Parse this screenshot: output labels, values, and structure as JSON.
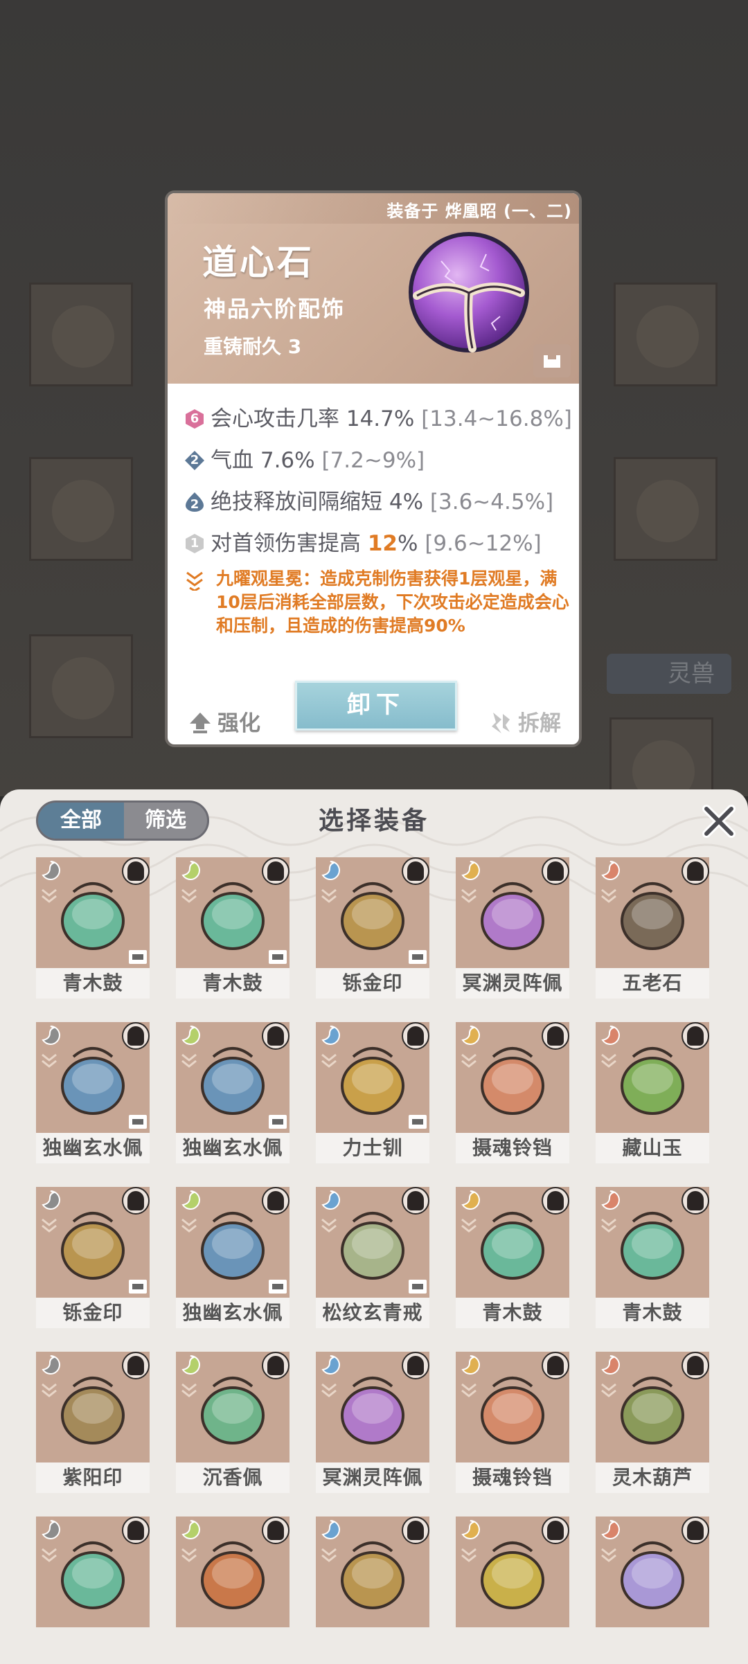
{
  "equipped_by": "装备于 烨凰昭 (一、二)",
  "item": {
    "name": "道心石",
    "grade": "神品六阶配饰",
    "durability": "重铸耐久 3"
  },
  "stats": [
    {
      "badge": "6",
      "badge_color": "#d9709a",
      "text": "会心攻击几率 14.7%",
      "range": "[13.4~16.8%]"
    },
    {
      "badge": "2",
      "badge_color": "#5c7896",
      "text": "气血 7.6%",
      "range": "[7.2~9%]"
    },
    {
      "badge": "2",
      "badge_color": "#5c7896",
      "text": "绝技释放间隔缩短 4%",
      "range": "[3.6~4.5%]"
    },
    {
      "badge": "1",
      "badge_color": "#c9c9c9",
      "text_pre": "对首领伤害提高 ",
      "text_hl": "12",
      "text_post": "%",
      "range": "[9.6~12%]"
    }
  ],
  "special": "九曜观星冕：造成克制伤害获得1层观星，满10层后消耗全部层数，下次攻击必定造成会心和压制，且造成的伤害提高90%",
  "actions": {
    "upgrade": "强化",
    "unequip": "卸下",
    "dismantle": "拆解"
  },
  "background": {
    "pet_label": "灵兽"
  },
  "panel": {
    "title": "选择装备",
    "tab_all": "全部",
    "tab_filter": "筛选"
  },
  "items": [
    {
      "name": "青木鼓",
      "icon": "drum-icon",
      "color": "#6ab89a"
    },
    {
      "name": "青木鼓",
      "icon": "drum-icon",
      "color": "#6ab89a"
    },
    {
      "name": "铄金印",
      "icon": "seal-icon",
      "color": "#b99550"
    },
    {
      "name": "冥渊灵阵佩",
      "icon": "orb-icon",
      "color": "#b07ac9"
    },
    {
      "name": "五老石",
      "icon": "stone-icon",
      "color": "#7a6a58"
    },
    {
      "name": "独幽玄水佩",
      "icon": "jar-icon",
      "color": "#6a94b8"
    },
    {
      "name": "独幽玄水佩",
      "icon": "jar-icon",
      "color": "#6a94b8"
    },
    {
      "name": "力士钏",
      "icon": "bracelet-icon",
      "color": "#c9a04a"
    },
    {
      "name": "摄魂铃铛",
      "icon": "bell-icon",
      "color": "#d48a6a"
    },
    {
      "name": "藏山玉",
      "icon": "jade-icon",
      "color": "#7fae58"
    },
    {
      "name": "铄金印",
      "icon": "seal-icon",
      "color": "#b99550"
    },
    {
      "name": "独幽玄水佩",
      "icon": "jar-icon",
      "color": "#6a94b8"
    },
    {
      "name": "松纹玄青戒",
      "icon": "ring-icon",
      "color": "#a7b48a"
    },
    {
      "name": "青木鼓",
      "icon": "drum-icon",
      "color": "#6ab89a"
    },
    {
      "name": "青木鼓",
      "icon": "drum-icon",
      "color": "#6ab89a"
    },
    {
      "name": "紫阳印",
      "icon": "seal-icon",
      "color": "#a48a5a"
    },
    {
      "name": "沉香佩",
      "icon": "pendant-icon",
      "color": "#6fb48a"
    },
    {
      "name": "冥渊灵阵佩",
      "icon": "orb-icon",
      "color": "#b07ac9"
    },
    {
      "name": "摄魂铃铛",
      "icon": "bell-icon",
      "color": "#d48a6a"
    },
    {
      "name": "灵木葫芦",
      "icon": "gourd-icon",
      "color": "#8a9a5a"
    },
    {
      "name": "",
      "icon": "drum-icon",
      "color": "#6ab89a"
    },
    {
      "name": "",
      "icon": "bag-icon",
      "color": "#c9784a"
    },
    {
      "name": "",
      "icon": "seal-icon",
      "color": "#b99550"
    },
    {
      "name": "",
      "icon": "crystal-icon",
      "color": "#c9b04a"
    },
    {
      "name": "",
      "icon": "gourd-icon",
      "color": "#a998d6"
    }
  ]
}
